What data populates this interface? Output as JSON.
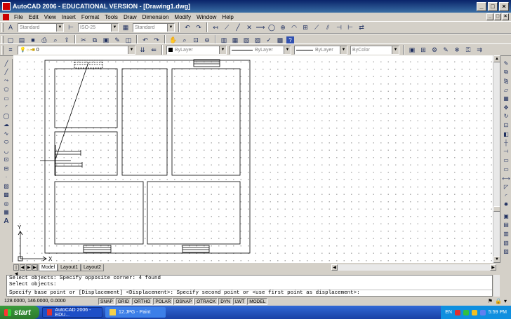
{
  "window": {
    "title": "AutoCAD 2006 - EDUCATIONAL VERSION - [Drawing1.dwg]"
  },
  "menu": [
    "File",
    "Edit",
    "View",
    "Insert",
    "Format",
    "Tools",
    "Draw",
    "Dimension",
    "Modify",
    "Window",
    "Help"
  ],
  "styles_toolbar": {
    "text_style": "Standard",
    "dim_style": "ISO-25",
    "table_style": "Standard"
  },
  "layers_toolbar": {
    "layer": "0"
  },
  "properties_toolbar": {
    "color": "ByLayer",
    "linetype": "ByLayer",
    "lineweight": "ByLayer",
    "plotstyle": "ByColor"
  },
  "layout_tabs": [
    "Model",
    "Layout1",
    "Layout2"
  ],
  "command_lines": [
    "Select objects: Specify opposite corner: 4 found",
    "Select objects:",
    "Specify base point or [Displacement] <Displacement>: Specify second point or <use first point as displacement>:"
  ],
  "status": {
    "coords": "128.0000, 146.0000, 0.0000",
    "toggles": [
      "SNAP",
      "GRID",
      "ORTHO",
      "POLAR",
      "OSNAP",
      "OTRACK",
      "DYN",
      "LWT",
      "MODEL"
    ]
  },
  "taskbar": {
    "start_label": "start",
    "items": [
      "AutoCAD 2006 - EDU...",
      "12.JPG - Paint"
    ],
    "lang": "EN",
    "clock": "5:59 PM"
  },
  "ucs": {
    "x_label": "X",
    "y_label": "Y"
  },
  "colors": {
    "title_bar": "#0a246a",
    "canvas": "#ffffff",
    "taskbar": "#245edb",
    "start": "#3c9a3c"
  }
}
